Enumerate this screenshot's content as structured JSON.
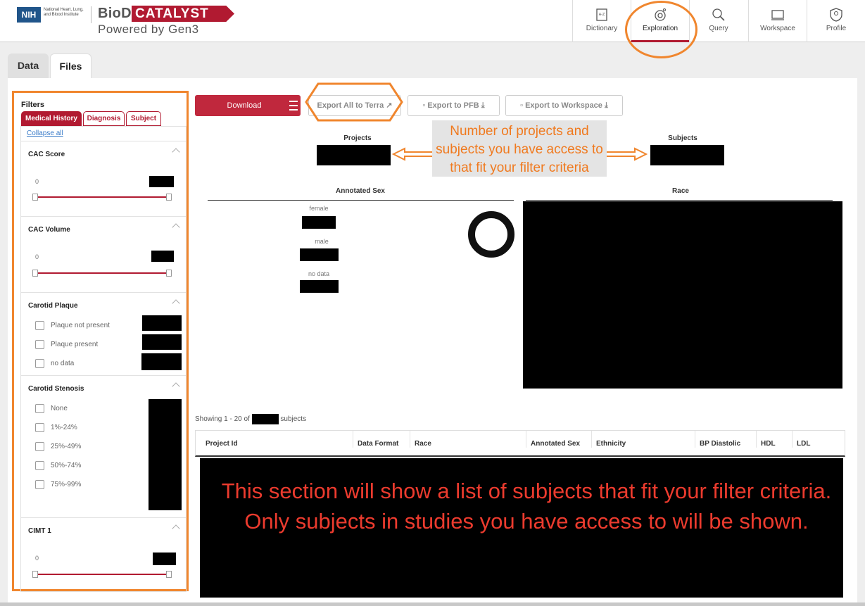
{
  "header": {
    "nih_logo": "NIH",
    "nih_text": "National Heart, Lung, and Blood Institute",
    "brand_primary": "BioData",
    "brand_catalyst": "CATALYST",
    "brand_sub": "Powered by Gen3",
    "nav": [
      {
        "label": "Dictionary",
        "icon": "dictionary-icon"
      },
      {
        "label": "Exploration",
        "icon": "exploration-icon",
        "active": true
      },
      {
        "label": "Query",
        "icon": "query-icon"
      },
      {
        "label": "Workspace",
        "icon": "workspace-icon"
      },
      {
        "label": "Profile",
        "icon": "profile-icon"
      }
    ]
  },
  "tabs": {
    "data": "Data",
    "files": "Files"
  },
  "filters": {
    "title": "Filters",
    "tabs": [
      "Medical History",
      "Diagnosis",
      "Subject"
    ],
    "collapse_all": "Collapse all",
    "sections": [
      {
        "title": "CAC Score",
        "min": "0"
      },
      {
        "title": "CAC Volume",
        "min": "0"
      },
      {
        "title": "Carotid Plaque",
        "options": [
          "Plaque not present",
          "Plaque present",
          "no data"
        ]
      },
      {
        "title": "Carotid Stenosis",
        "options": [
          "None",
          "1%-24%",
          "25%-49%",
          "50%-74%",
          "75%-99%"
        ]
      },
      {
        "title": "CIMT 1",
        "min": "0"
      }
    ]
  },
  "actions": {
    "download": "Download",
    "export_terra": "Export All to Terra",
    "export_pfb": "Export to PFB",
    "export_workspace": "Export to Workspace"
  },
  "summary": {
    "projects_label": "Projects",
    "subjects_label": "Subjects",
    "callout": "Number of projects and subjects you have access to that fit your filter criteria"
  },
  "charts": {
    "sex_title": "Annotated Sex",
    "sex_categories": [
      "female",
      "male",
      "no data"
    ],
    "race_title": "Race"
  },
  "table": {
    "showing_prefix": "Showing 1 - 20 of",
    "showing_suffix": "subjects",
    "columns": [
      "Project Id",
      "Data Format",
      "Race",
      "Annotated Sex",
      "Ethnicity",
      "BP Diastolic",
      "HDL",
      "LDL"
    ],
    "message": "This section will show a list of subjects that fit your filter criteria. Only subjects in studies you have access to will be shown."
  },
  "colors": {
    "brand_red": "#b11a31",
    "annotation_orange": "#f0862e",
    "message_red": "#ec3b2e"
  }
}
